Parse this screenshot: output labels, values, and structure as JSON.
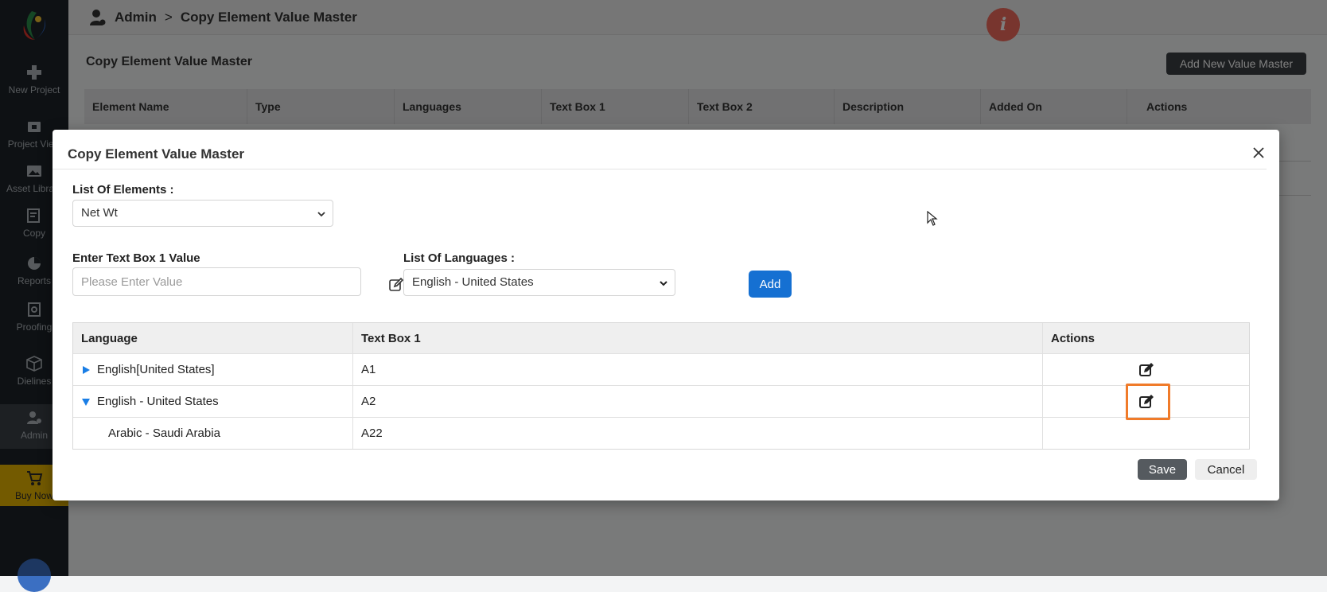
{
  "sidebar": {
    "items": [
      {
        "label": "New Project",
        "icon": "plus-icon"
      },
      {
        "label": "Project View",
        "icon": "folder-icon"
      },
      {
        "label": "Asset Library",
        "icon": "image-icon"
      },
      {
        "label": "Copy",
        "icon": "edit-doc-icon"
      },
      {
        "label": "Reports",
        "icon": "pie-chart-icon"
      },
      {
        "label": "Proofing",
        "icon": "proofing-icon"
      },
      {
        "label": "Dielines",
        "icon": "box-icon"
      },
      {
        "label": "Admin",
        "icon": "admin-user-icon",
        "active": true
      },
      {
        "label": "Buy Now",
        "icon": "cart-icon"
      }
    ]
  },
  "topbar": {
    "crumb_root": "Admin",
    "crumb_sep": ">",
    "crumb_page": "Copy Element Value Master"
  },
  "page": {
    "title": "Copy Element Value Master",
    "add_new_label": "Add New Value Master",
    "columns": [
      "Element Name",
      "Type",
      "Languages",
      "Text Box 1",
      "Text Box 2",
      "Description",
      "Added On",
      "Actions"
    ]
  },
  "modal": {
    "title": "Copy Element Value Master",
    "elements_label": "List Of Elements :",
    "elements_selected": "Net Wt",
    "textbox_label": "Enter Text Box 1 Value",
    "textbox_placeholder": "Please Enter Value",
    "languages_label": "List Of Languages :",
    "languages_selected": "English - United States",
    "add_label": "Add",
    "table": {
      "headers": [
        "Language",
        "Text Box 1",
        "Actions"
      ],
      "rows": [
        {
          "language": "English[United States]",
          "textbox1": "A1",
          "expanded": false
        },
        {
          "language": "English - United States",
          "textbox1": "A2",
          "expanded": true
        },
        {
          "language": "Arabic - Saudi Arabia",
          "textbox1": "A22",
          "child": true
        }
      ]
    },
    "save_label": "Save",
    "cancel_label": "Cancel"
  },
  "colors": {
    "primary": "#1570d2",
    "highlight": "#f07b2a",
    "info": "#f06a5c",
    "sidebar_bg": "#1d2328",
    "buy_now_bg": "#e7b400",
    "expand_arrow": "#1a7ee6"
  }
}
